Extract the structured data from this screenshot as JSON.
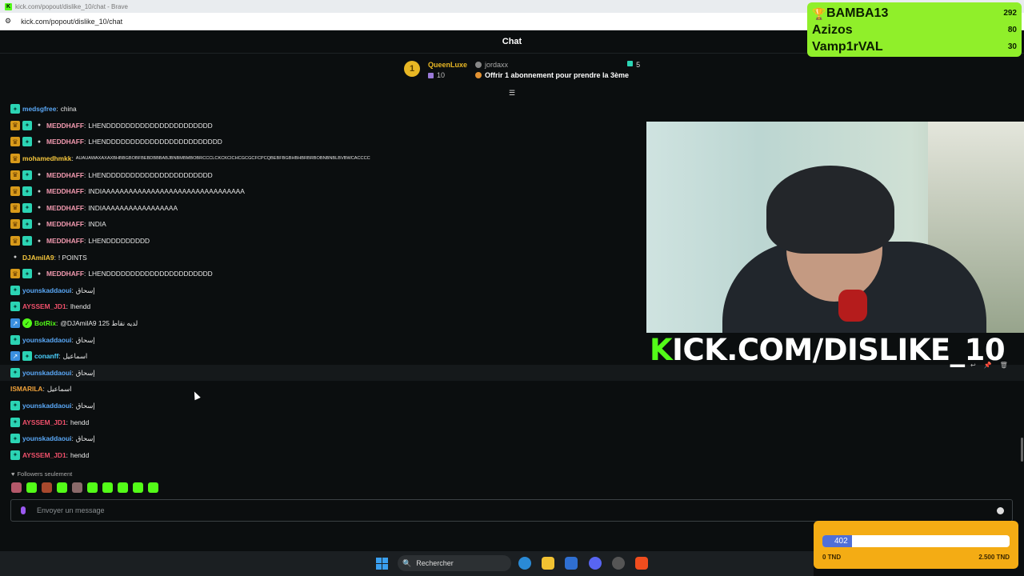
{
  "browser": {
    "window_title": "kick.com/popout/dislike_10/chat - Brave",
    "url": "kick.com/popout/dislike_10/chat"
  },
  "chat": {
    "header_title": "Chat",
    "pinned": {
      "rank": "1",
      "top_gifter": "QueenLuxe",
      "top_gifter_count": "10",
      "second_user": "jordaxx",
      "offer_text": "Offrir 1 abonnement pour prendre la 3ème",
      "count": "5"
    },
    "messages": [
      {
        "badges": [
          "sub"
        ],
        "user": "medsgfree",
        "color": "c-blue",
        "text": "china"
      },
      {
        "badges": [
          "crown",
          "sub",
          "gem"
        ],
        "user": "MEDDHAFF",
        "color": "c-pink",
        "text": "LHENDDDDDDDDDDDDDDDDDDDDDD"
      },
      {
        "badges": [
          "crown",
          "sub",
          "gem"
        ],
        "user": "MEDDHAFF",
        "color": "c-pink",
        "text": "LHENDDDDDDDDDDDDDDDDDDDDDDDD"
      },
      {
        "badges": [
          "crown"
        ],
        "user": "mohamedhmkk",
        "color": "c-yellow",
        "text": "AUAUAWAXAXAXBHBBGBOBFBEBDBBBABJBNBMBMBOBRCCCLCKCKCICHCGCGCFCPCQBEBFBGBHBHBRBRBOBNBNBLBVBWCACCCC",
        "tiny": true
      },
      {
        "badges": [
          "crown",
          "sub",
          "gem"
        ],
        "user": "MEDDHAFF",
        "color": "c-pink",
        "text": "LHENDDDDDDDDDDDDDDDDDDDDDD"
      },
      {
        "badges": [
          "crown",
          "sub",
          "gem"
        ],
        "user": "MEDDHAFF",
        "color": "c-pink",
        "text": "INDIAAAAAAAAAAAAAAAAAAAAAAAAAAAAAAAA"
      },
      {
        "badges": [
          "crown",
          "sub",
          "gem"
        ],
        "user": "MEDDHAFF",
        "color": "c-pink",
        "text": "INDIAAAAAAAAAAAAAAAAA"
      },
      {
        "badges": [
          "crown",
          "sub",
          "gem"
        ],
        "user": "MEDDHAFF",
        "color": "c-pink",
        "text": "INDIA"
      },
      {
        "badges": [
          "crown",
          "sub",
          "gem"
        ],
        "user": "MEDDHAFF",
        "color": "c-pink",
        "text": "LHENDDDDDDDDD"
      },
      {
        "badges": [
          "gem"
        ],
        "user": "DJAmilA9",
        "color": "c-yellow",
        "text": "! POINTS"
      },
      {
        "badges": [
          "crown",
          "sub",
          "gem"
        ],
        "user": "MEDDHAFF",
        "color": "c-pink",
        "text": "LHENDDDDDDDDDDDDDDDDDDDDDD"
      },
      {
        "badges": [
          "sub"
        ],
        "user": "younskaddaoui",
        "color": "c-blue",
        "text": "إسحاق"
      },
      {
        "badges": [
          "sub"
        ],
        "user": "AYSSEM_JD1",
        "color": "c-red",
        "text": "lhendd"
      },
      {
        "badges": [
          "vip",
          "bot"
        ],
        "user": "BotRix",
        "color": "c-green",
        "text": "@DJAmilA9 125 لديه نقاط"
      },
      {
        "badges": [
          "sub"
        ],
        "user": "younskaddaoui",
        "color": "c-blue",
        "text": "إسحاق"
      },
      {
        "badges": [
          "vip",
          "sub"
        ],
        "user": "conanff",
        "color": "c-teal",
        "text": "اسماعيل"
      },
      {
        "badges": [
          "sub"
        ],
        "user": "younskaddaoui",
        "color": "c-blue",
        "text": "إسحاق",
        "highlight": true
      },
      {
        "badges": [],
        "user": "ISMARILA",
        "color": "c-orange",
        "text": "اسماعيل"
      },
      {
        "badges": [
          "sub"
        ],
        "user": "younskaddaoui",
        "color": "c-blue",
        "text": "إسحاق"
      },
      {
        "badges": [
          "sub"
        ],
        "user": "AYSSEM_JD1",
        "color": "c-red",
        "text": "hendd"
      },
      {
        "badges": [
          "sub"
        ],
        "user": "younskaddaoui",
        "color": "c-blue",
        "text": "إسحاق"
      },
      {
        "badges": [
          "sub"
        ],
        "user": "AYSSEM_JD1",
        "color": "c-red",
        "text": "hendd"
      }
    ],
    "followers_only": "Followers seulement",
    "input_placeholder": "Envoyer un message"
  },
  "overlay": {
    "banner_k": "K",
    "banner_text": "ICK.COM/DISLIKE_10",
    "leaderboard": [
      {
        "name": "BAMBA13",
        "score": "292"
      },
      {
        "name": "Azizos",
        "score": "80"
      },
      {
        "name": "Vamp1rVAL",
        "score": "30"
      }
    ],
    "goal": {
      "current": "402",
      "min": "0 TND",
      "max": "2.500 TND",
      "progress": 0.16
    }
  },
  "taskbar": {
    "search_label": "Rechercher"
  },
  "colors": {
    "kick_green": "#53fc18",
    "leaderboard_bg": "#90ef2a",
    "goal_bg": "#f4ac14",
    "goal_fill": "#4f6fd8"
  }
}
